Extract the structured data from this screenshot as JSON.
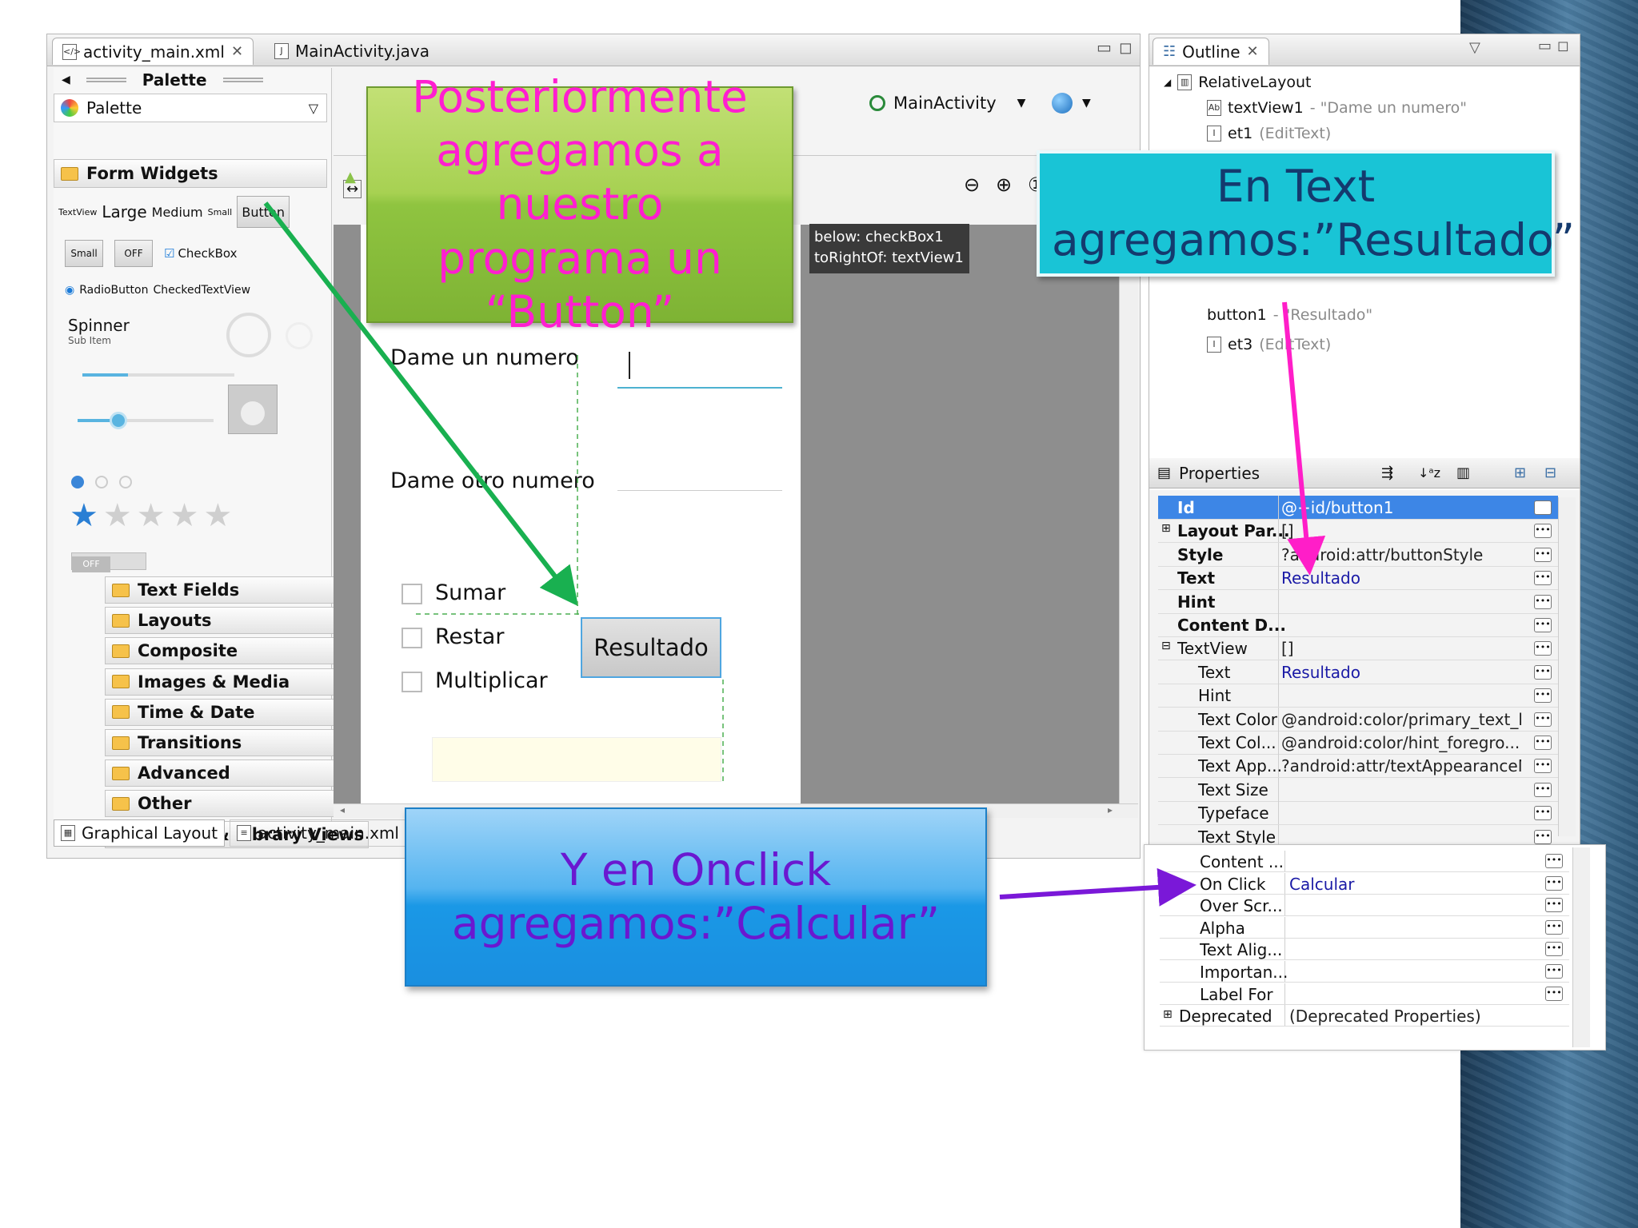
{
  "editor": {
    "tabs": [
      "activity_main.xml",
      "MainActivity.java"
    ],
    "palette_header": "Palette",
    "palette_selector": "Palette",
    "form_widgets": "Form Widgets",
    "widgets": {
      "textview": "TextView",
      "large": "Large",
      "medium": "Medium",
      "small": "Small",
      "button": "Button",
      "small_btn": "Small",
      "off_btn": "OFF",
      "checkbox": "CheckBox",
      "radiobutton": "RadioButton",
      "checkedtextview": "CheckedTextView",
      "spinner": "Spinner",
      "spinner_sub": "Sub Item",
      "switch_off": "OFF"
    },
    "categories": [
      "Text Fields",
      "Layouts",
      "Composite",
      "Images & Media",
      "Time & Date",
      "Transitions",
      "Advanced",
      "Other",
      "Custom & Library Views"
    ],
    "bottom_tabs": [
      "Graphical Layout",
      "activity_main.xml"
    ],
    "toolbar_activity": "MainActivity",
    "tooltip": [
      "below: checkBox1",
      "toRightOf: textView1"
    ],
    "canvas": {
      "label1": "Dame un numero",
      "label2": "Dame otro numero",
      "checkboxes": [
        "Sumar",
        "Restar",
        "Multiplicar"
      ],
      "button": "Resultado"
    }
  },
  "outline": {
    "title": "Outline",
    "items": [
      {
        "name": "RelativeLayout",
        "detail": ""
      },
      {
        "name": "textView1",
        "detail": " - \"Dame un numero\""
      },
      {
        "name": "et1",
        "detail": " (EditText)"
      },
      {
        "name": "button1",
        "detail": " - \"Resultado\""
      },
      {
        "name": "et3",
        "detail": " (EditText)"
      }
    ]
  },
  "properties": {
    "title": "Properties",
    "rows": [
      {
        "key": "Id",
        "value": "@+id/button1"
      },
      {
        "key": "Layout Par...",
        "value": "[]"
      },
      {
        "key": "Style",
        "value": "?android:attr/buttonStyle"
      },
      {
        "key": "Text",
        "value": "Resultado"
      },
      {
        "key": "Hint",
        "value": ""
      },
      {
        "key": "Content D...",
        "value": ""
      },
      {
        "key": "TextView",
        "value": "[]"
      },
      {
        "key": "Text",
        "value": "Resultado"
      },
      {
        "key": "Hint",
        "value": ""
      },
      {
        "key": "Text Color",
        "value": "@android:color/primary_text_h..."
      },
      {
        "key": "Text Col...",
        "value": "@android:color/hint_foregro..."
      },
      {
        "key": "Text App...",
        "value": "?android:attr/textAppearanceM..."
      },
      {
        "key": "Text Size",
        "value": ""
      },
      {
        "key": "Typeface",
        "value": ""
      },
      {
        "key": "Text Style",
        "value": ""
      }
    ],
    "rows2": [
      {
        "key": "Content ...",
        "value": ""
      },
      {
        "key": "On Click",
        "value": "Calcular"
      },
      {
        "key": "Over Scr...",
        "value": ""
      },
      {
        "key": "Alpha",
        "value": ""
      },
      {
        "key": "Text Alig...",
        "value": ""
      },
      {
        "key": "Importan...",
        "value": ""
      },
      {
        "key": "Label For",
        "value": ""
      },
      {
        "key": "Deprecated",
        "value": "(Deprecated Properties)"
      }
    ]
  },
  "callouts": {
    "green": "Posteriormente agregamos a nuestro programa un “Button”",
    "cyan": "En Text agregamos:”Resultado”",
    "blue": "Y en Onclick agregamos:”Calcular”"
  },
  "colors": {
    "green_callout": "#8fc440",
    "green_text": "#ff1ed0",
    "cyan_callout": "#19c4d6",
    "cyan_text": "#143a6e",
    "blue_callout": "#1a98e6",
    "blue_text": "#6a18d0",
    "arrow_green": "#19b050",
    "arrow_pink": "#ff1ec8",
    "arrow_purple": "#7a18d8",
    "selection": "#3d86e6"
  }
}
